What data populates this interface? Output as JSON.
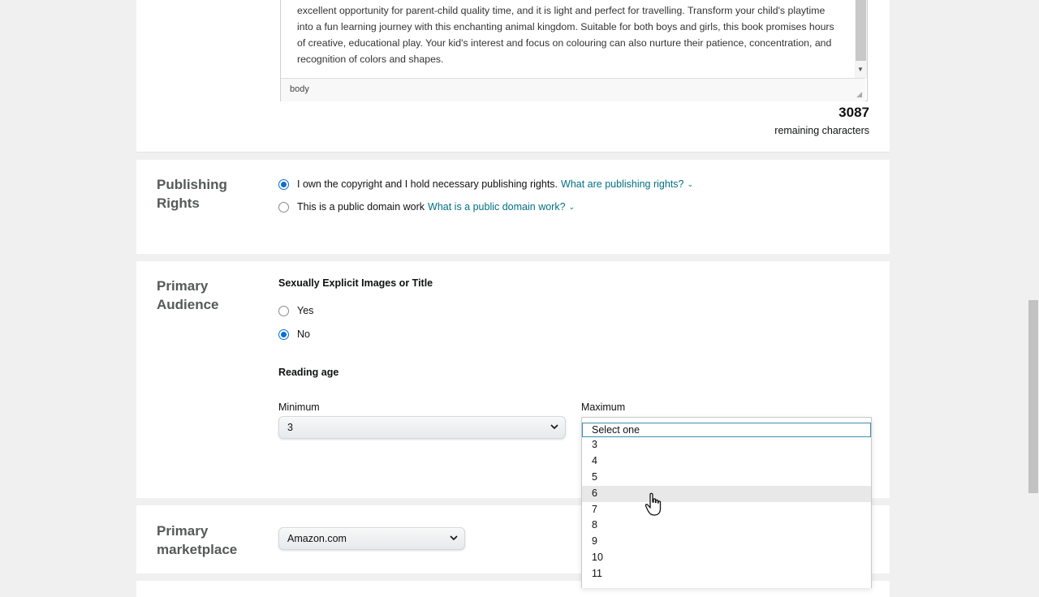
{
  "description": {
    "lines": [
      "excellent opportunity for parent-child quality time, and it is light and perfect for travelling. Transform your child's playtime",
      "into a fun learning journey with this enchanting animal kingdom. Suitable for both boys and girls, this book promises hours",
      "of creative, educational play. Your kid's interest and focus on colouring can also nurture their patience, concentration, and",
      "recognition of colors and shapes."
    ],
    "status_path": "body",
    "remaining_count": "3087",
    "remaining_label": "remaining characters"
  },
  "publishing_rights": {
    "title_line1": "Publishing",
    "title_line2": "Rights",
    "option_own": "I own the copyright and I hold necessary publishing rights.",
    "option_own_link": "What are publishing rights?",
    "option_public": "This is a public domain work",
    "option_public_link": "What is a public domain work?",
    "selected": "own"
  },
  "primary_audience": {
    "title_line1": "Primary",
    "title_line2": "Audience",
    "explicit_label": "Sexually Explicit Images or Title",
    "yes_label": "Yes",
    "no_label": "No",
    "explicit_selected": "No",
    "reading_age_label": "Reading age",
    "minimum_label": "Minimum",
    "minimum_value": "3",
    "maximum_label": "Maximum",
    "maximum_options": [
      "Select one",
      "3",
      "4",
      "5",
      "6",
      "7",
      "8",
      "9",
      "10",
      "11"
    ],
    "maximum_highlighted": "Select one",
    "maximum_hovered": "6"
  },
  "primary_marketplace": {
    "title_line1": "Primary",
    "title_line2": "marketplace",
    "value": "Amazon.com"
  },
  "colors": {
    "link": "#007185",
    "radio_checked": "#0a6ed1",
    "section_title": "#565959"
  }
}
